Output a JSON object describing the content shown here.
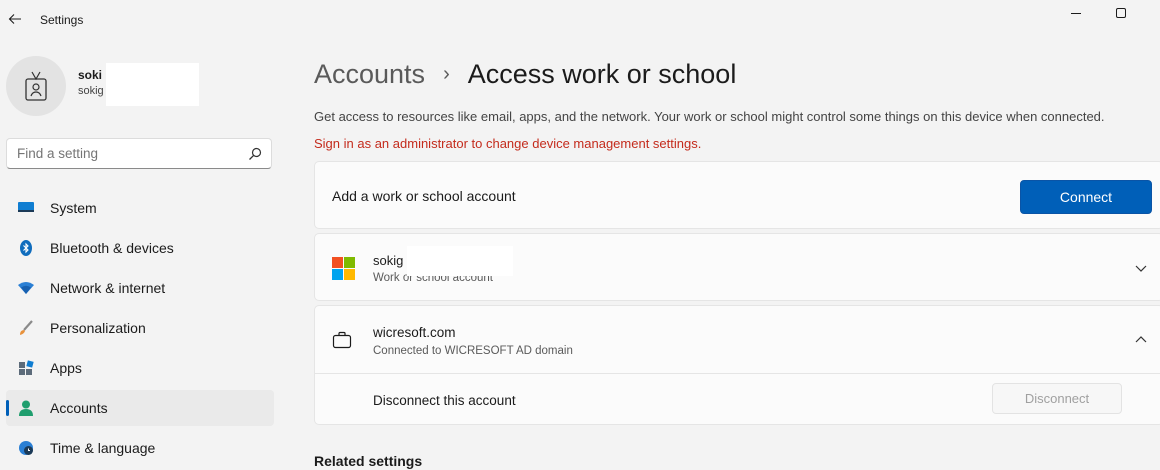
{
  "window": {
    "title": "Settings",
    "minimize_glyph": "—",
    "maximize_glyph": "☐"
  },
  "profile": {
    "name": "soki",
    "email": "sokig"
  },
  "search": {
    "placeholder": "Find a setting"
  },
  "sidebar": {
    "items": [
      {
        "label": "System",
        "icon": "monitor-icon"
      },
      {
        "label": "Bluetooth & devices",
        "icon": "bluetooth-icon"
      },
      {
        "label": "Network & internet",
        "icon": "wifi-icon"
      },
      {
        "label": "Personalization",
        "icon": "brush-icon"
      },
      {
        "label": "Apps",
        "icon": "apps-icon"
      },
      {
        "label": "Accounts",
        "icon": "person-icon",
        "active": true
      },
      {
        "label": "Time & language",
        "icon": "globe-clock-icon"
      }
    ]
  },
  "breadcrumb": {
    "parent": "Accounts",
    "separator": "›",
    "current": "Access work or school"
  },
  "main": {
    "description": "Get access to resources like email, apps, and the network. Your work or school might control some things on this device when connected.",
    "admin_warning": "Sign in as an administrator to change device management settings.",
    "add_account": {
      "label": "Add a work or school account",
      "button": "Connect"
    },
    "accounts": [
      {
        "title": "sokig",
        "subtitle": "Work or school account"
      },
      {
        "title": "wicresoft.com",
        "subtitle": "Connected to WICRESOFT AD domain",
        "disconnect_label": "Disconnect this account",
        "disconnect_button": "Disconnect"
      }
    ],
    "related_heading": "Related settings"
  },
  "colors": {
    "accent": "#005fb8",
    "warning": "#c42b1c",
    "background": "#f3f3f3",
    "card": "#fbfbfb"
  }
}
